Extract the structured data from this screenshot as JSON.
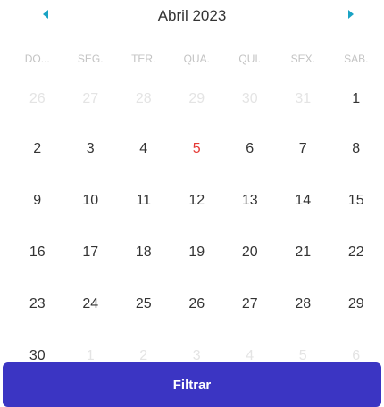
{
  "header": {
    "month_title": "Abril 2023",
    "prev_icon": "caret-left-icon",
    "next_icon": "caret-right-icon",
    "arrow_color": "#1aa3c4"
  },
  "weekdays": [
    "DO...",
    "SEG.",
    "TER.",
    "QUA.",
    "QUI.",
    "SEX.",
    "SAB."
  ],
  "weeks": [
    [
      {
        "label": "26",
        "state": "other"
      },
      {
        "label": "27",
        "state": "other"
      },
      {
        "label": "28",
        "state": "other"
      },
      {
        "label": "29",
        "state": "other"
      },
      {
        "label": "30",
        "state": "other"
      },
      {
        "label": "31",
        "state": "other"
      },
      {
        "label": "1",
        "state": "current"
      }
    ],
    [
      {
        "label": "2",
        "state": "current"
      },
      {
        "label": "3",
        "state": "current"
      },
      {
        "label": "4",
        "state": "current"
      },
      {
        "label": "5",
        "state": "today"
      },
      {
        "label": "6",
        "state": "current"
      },
      {
        "label": "7",
        "state": "current"
      },
      {
        "label": "8",
        "state": "current"
      }
    ],
    [
      {
        "label": "9",
        "state": "current"
      },
      {
        "label": "10",
        "state": "current"
      },
      {
        "label": "11",
        "state": "current"
      },
      {
        "label": "12",
        "state": "current"
      },
      {
        "label": "13",
        "state": "current"
      },
      {
        "label": "14",
        "state": "current"
      },
      {
        "label": "15",
        "state": "current"
      }
    ],
    [
      {
        "label": "16",
        "state": "current"
      },
      {
        "label": "17",
        "state": "current"
      },
      {
        "label": "18",
        "state": "current"
      },
      {
        "label": "19",
        "state": "current"
      },
      {
        "label": "20",
        "state": "current"
      },
      {
        "label": "21",
        "state": "current"
      },
      {
        "label": "22",
        "state": "current"
      }
    ],
    [
      {
        "label": "23",
        "state": "current"
      },
      {
        "label": "24",
        "state": "current"
      },
      {
        "label": "25",
        "state": "current"
      },
      {
        "label": "26",
        "state": "current"
      },
      {
        "label": "27",
        "state": "current"
      },
      {
        "label": "28",
        "state": "current"
      },
      {
        "label": "29",
        "state": "current"
      }
    ],
    [
      {
        "label": "30",
        "state": "current"
      },
      {
        "label": "1",
        "state": "other"
      },
      {
        "label": "2",
        "state": "other"
      },
      {
        "label": "3",
        "state": "other"
      },
      {
        "label": "4",
        "state": "other"
      },
      {
        "label": "5",
        "state": "other"
      },
      {
        "label": "6",
        "state": "other"
      }
    ]
  ],
  "colors": {
    "today": "#e53935",
    "button_bg": "#3b35c3"
  },
  "filter_button": {
    "label": "Filtrar"
  }
}
